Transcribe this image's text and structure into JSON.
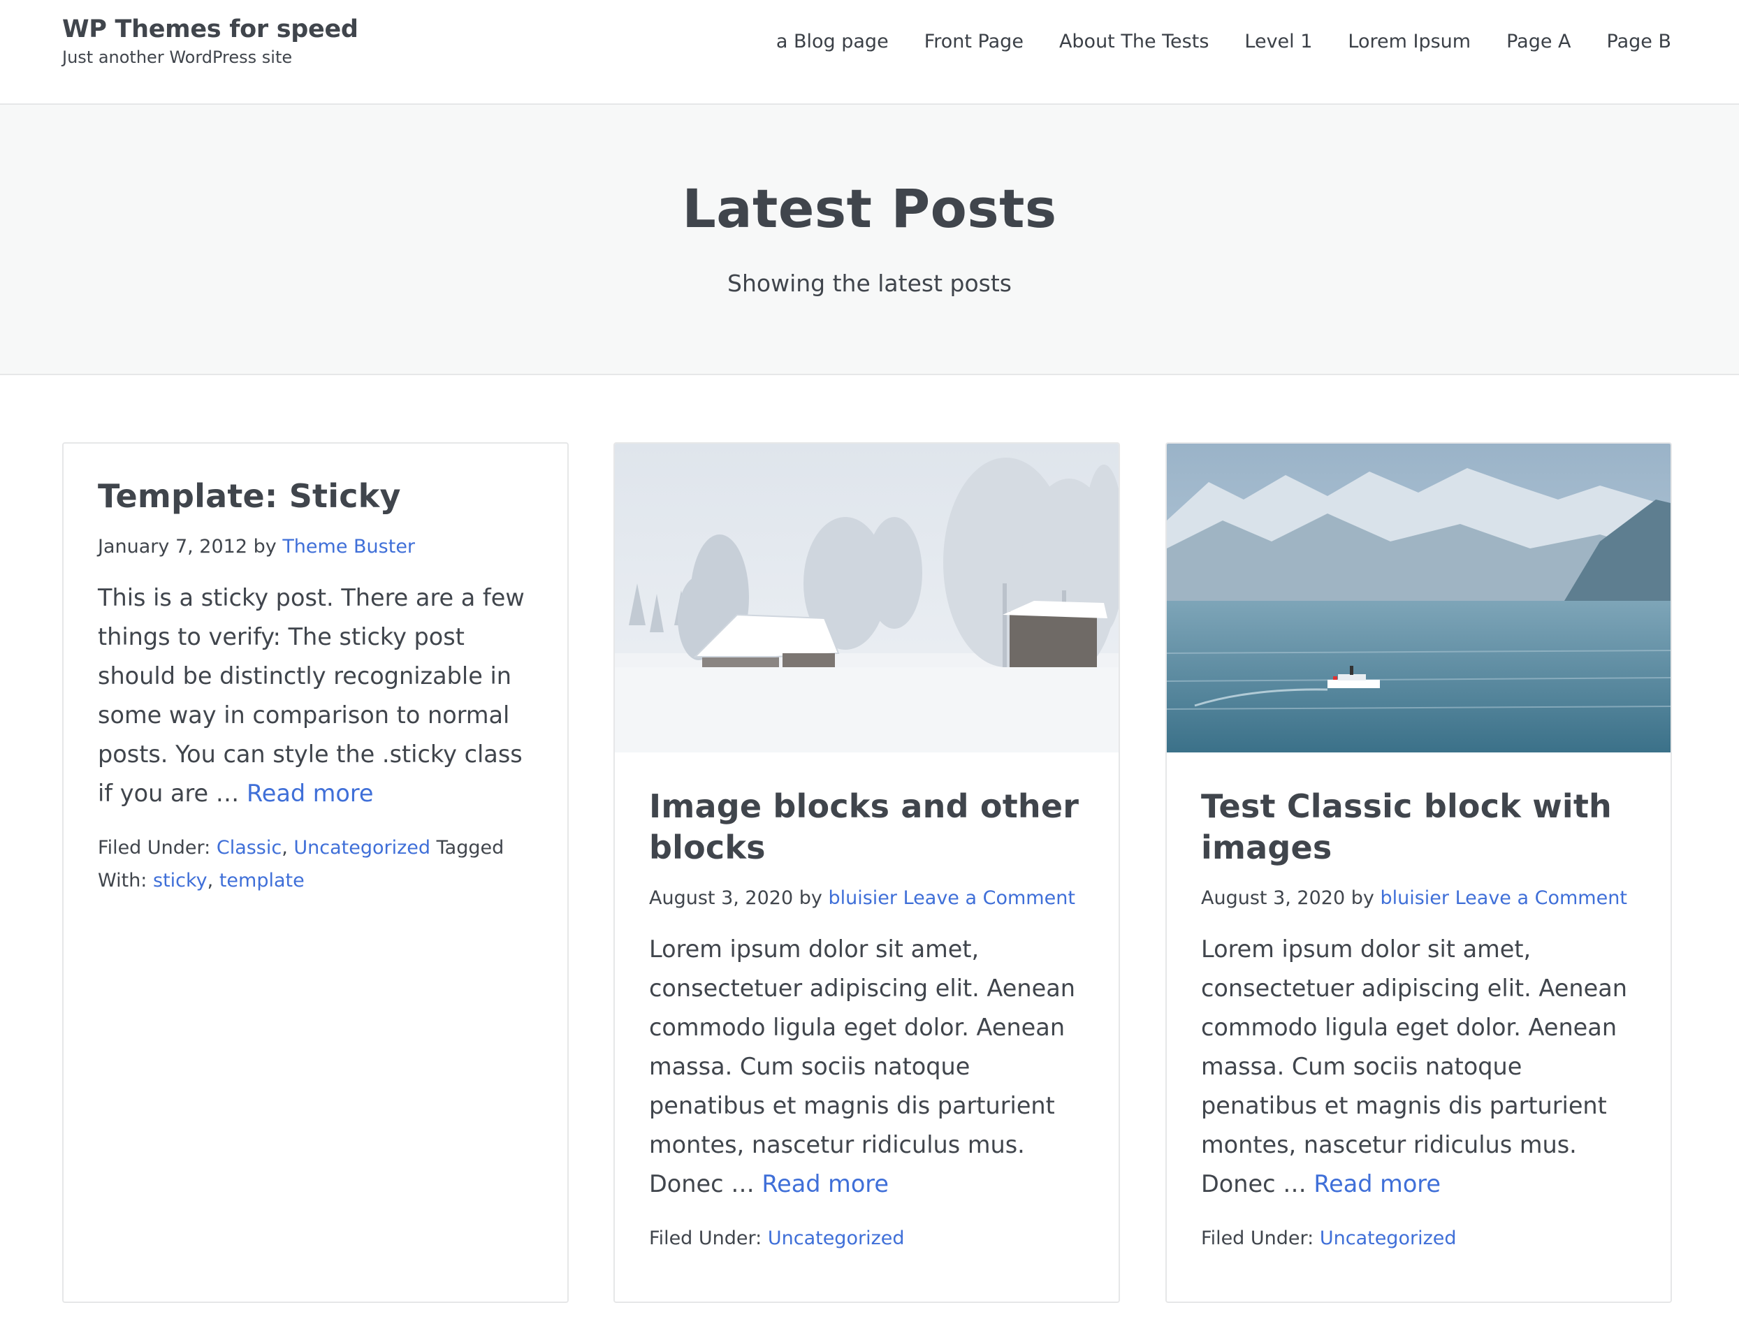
{
  "site": {
    "title": "WP Themes for speed",
    "tagline": "Just another WordPress site"
  },
  "nav": {
    "items": [
      "a Blog page",
      "Front Page",
      "About The Tests",
      "Level 1",
      "Lorem Ipsum",
      "Page A",
      "Page B"
    ]
  },
  "hero": {
    "title": "Latest Posts",
    "subtitle": "Showing the latest posts"
  },
  "colors": {
    "link": "#3f6fd8",
    "text": "#40454c",
    "hero_bg": "#f7f8f8",
    "border": "#e6e7e8"
  },
  "posts": [
    {
      "title": "Template: Sticky",
      "date": "January 7, 2012",
      "by": "by",
      "author": "Theme Buster",
      "comment_link": "",
      "excerpt": "This is a sticky post. There are a few things to verify: The sticky post should be distinctly recognizable in some way in comparison to normal posts. You can style the .sticky class if you are …",
      "read_more": "Read more",
      "filed_label": "Filed Under:",
      "categories": [
        "Classic",
        "Uncategorized"
      ],
      "tagged_label": "Tagged With:",
      "tags": [
        "sticky",
        "template"
      ],
      "image": ""
    },
    {
      "title": "Image blocks and other blocks",
      "date": "August 3, 2020",
      "by": "by",
      "author": "bluisier",
      "comment_link": "Leave a Comment",
      "excerpt": "Lorem ipsum dolor sit amet, consectetuer adipiscing elit. Aenean commodo ligula eget dolor. Aenean massa. Cum sociis natoque penatibus et magnis dis parturient montes, nascetur ridiculus mus. Donec …",
      "read_more": "Read more",
      "filed_label": "Filed Under:",
      "categories": [
        "Uncategorized"
      ],
      "image": "snowy-cabin-photo"
    },
    {
      "title": "Test Classic block with images",
      "date": "August 3, 2020",
      "by": "by",
      "author": "bluisier",
      "comment_link": "Leave a Comment",
      "excerpt": "Lorem ipsum dolor sit amet, consectetuer adipiscing elit. Aenean commodo ligula eget dolor. Aenean massa. Cum sociis natoque penatibus et magnis dis parturient montes, nascetur ridiculus mus. Donec …",
      "read_more": "Read more",
      "filed_label": "Filed Under:",
      "categories": [
        "Uncategorized"
      ],
      "image": "mountain-lake-boat-photo"
    }
  ]
}
